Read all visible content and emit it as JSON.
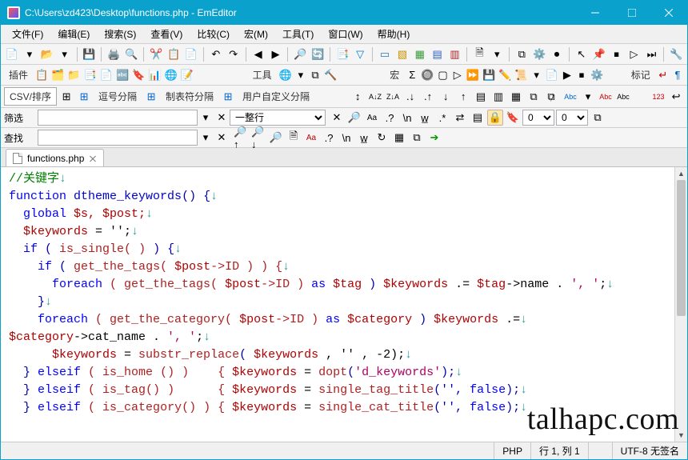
{
  "title": "C:\\Users\\zd423\\Desktop\\functions.php - EmEditor",
  "menu": [
    "文件(F)",
    "编辑(E)",
    "搜索(S)",
    "查看(V)",
    "比较(C)",
    "宏(M)",
    "工具(T)",
    "窗口(W)",
    "帮助(H)"
  ],
  "toolbar2": {
    "plugins_label": "插件",
    "tools_label": "工具",
    "macro_label": "宏",
    "marks_label": "标记"
  },
  "csv_row": {
    "label": "CSV/排序",
    "btns": [
      "逗号分隔",
      "制表符分隔",
      "用户自定义分隔"
    ]
  },
  "filter": {
    "label": "筛选",
    "combo": "一整行",
    "zero": "0"
  },
  "find": {
    "label": "查找"
  },
  "tab": {
    "name": "functions.php"
  },
  "status": {
    "lang": "PHP",
    "pos": "行 1, 列 1",
    "enc": "UTF-8 无签名"
  },
  "watermark": "talhapc.com",
  "code": {
    "l1_comment": "//关键字",
    "l2_kw": "function",
    "l2_name": "dtheme_keywords",
    "l2_rest": "() {",
    "l3_kw": "global",
    "l3_vars": " $s, $post;",
    "l4_var": "$keywords",
    "l4_rest": " = '';",
    "l5_kw": "if",
    "l5_call": " is_single( ) ",
    "l5_open": "{",
    "l6_kw": "if",
    "l6a": " get_the_tags( ",
    "l6v": "$post",
    "l6b": "->ID ) ) {",
    "l7_kw": "foreach",
    "l7a": " ( get_the_tags( ",
    "l7v1": "$post",
    "l7b": "->ID ) ",
    "l7as": "as",
    "l7v2": " $tag ",
    "l7c": ") ",
    "l7v3": "$keywords",
    "l7d": " .= ",
    "l7v4": "$tag",
    "l7e": "->name . ",
    "l7s": "', '",
    "l7f": ";",
    "l8": "}",
    "l9_kw": "foreach",
    "l9a": " ( get_the_category( ",
    "l9v": "$post",
    "l9b": "->ID ) ",
    "l9as": "as",
    "l9v2": " $category ",
    "l9c": ") ",
    "l9v3": "$keywords",
    "l9d": " .=",
    "l10v": "$category",
    "l10a": "->cat_name . ",
    "l10s": "', '",
    "l10b": ";",
    "l11v": "$keywords",
    "l11a": " = ",
    "l11f": "substr_replace",
    "l11b": "( ",
    "l11v2": "$keywords",
    "l11c": " , '' , -2);",
    "l12a": "} ",
    "l12kw": "elseif",
    "l12b": " ( is_home () )    { ",
    "l12v": "$keywords",
    "l12c": " = ",
    "l12f": "dopt",
    "l12d": "(",
    "l12s": "'d_keywords'",
    "l12e": ");",
    "l13a": "} ",
    "l13kw": "elseif",
    "l13b": " ( is_tag() )      { ",
    "l13v": "$keywords",
    "l13c": " = ",
    "l13f": "single_tag_title",
    "l13d": "('', ",
    "l13k2": "false",
    "l13e": ");",
    "l14a": "} ",
    "l14kw": "elseif",
    "l14b": " ( is_category() ) { ",
    "l14v": "$keywords",
    "l14c": " = ",
    "l14f": "single_cat_title",
    "l14d": "('', ",
    "l14k2": "false",
    "l14e": ");"
  }
}
